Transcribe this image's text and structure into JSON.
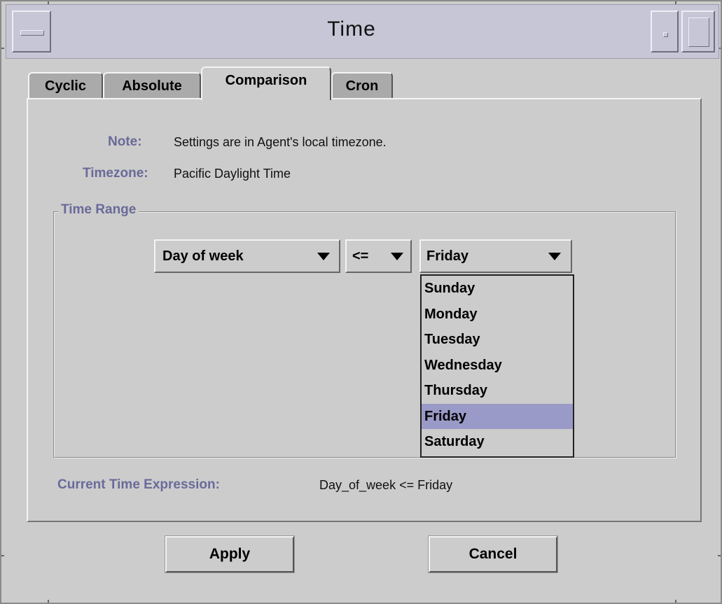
{
  "window": {
    "title": "Time"
  },
  "tabs": [
    {
      "label": "Cyclic",
      "active": false
    },
    {
      "label": "Absolute",
      "active": false
    },
    {
      "label": "Comparison",
      "active": true
    },
    {
      "label": "Cron",
      "active": false
    }
  ],
  "info": {
    "note_label": "Note:",
    "note_value": "Settings are in Agent's local timezone.",
    "timezone_label": "Timezone:",
    "timezone_value": "Pacific Daylight Time"
  },
  "time_range": {
    "legend": "Time Range",
    "field_value": "Day of week",
    "operator_value": "<=",
    "day_value": "Friday",
    "day_options": [
      "Sunday",
      "Monday",
      "Tuesday",
      "Wednesday",
      "Thursday",
      "Friday",
      "Saturday"
    ],
    "selected_option": "Friday"
  },
  "expression": {
    "label": "Current Time Expression:",
    "value": "Day_of_week <= Friday"
  },
  "buttons": {
    "apply": "Apply",
    "cancel": "Cancel"
  },
  "colors": {
    "accent_label": "#6a6a9a",
    "selection": "#9a9ac8",
    "title_bar": "#c6c6d6"
  }
}
